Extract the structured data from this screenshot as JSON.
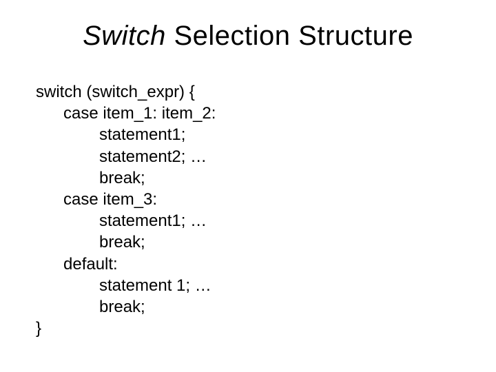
{
  "title": {
    "italic": "Switch",
    "rest": " Selection Structure"
  },
  "code": {
    "l1": "switch (switch_expr) {",
    "l2": "case item_1: item_2:",
    "l3": "statement1;",
    "l4": "statement2; …",
    "l5": "break;",
    "l6": "case item_3:",
    "l7": "statement1; …",
    "l8": "break;",
    "l9": "default:",
    "l10": "statement 1;  …",
    "l11": "break;",
    "l12": "}"
  }
}
